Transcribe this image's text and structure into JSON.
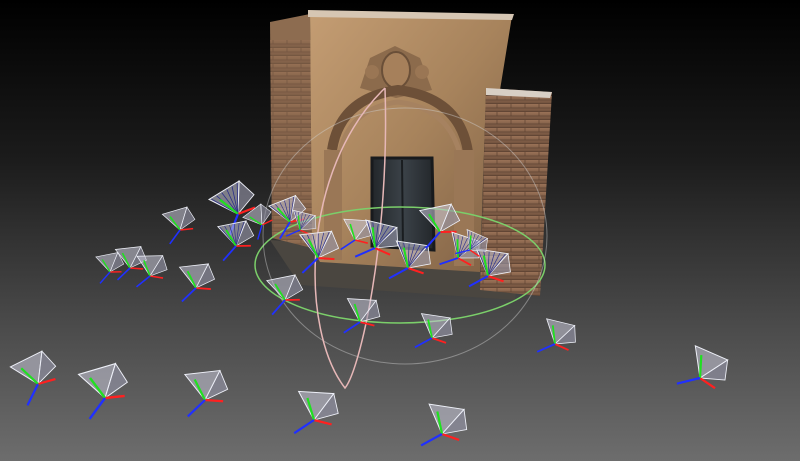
{
  "viewport": {
    "background_top": "#000000",
    "background_bottom": "#6d6d6d"
  },
  "model": {
    "subject": "photogrammetry-reconstruction-church-portal",
    "stone_color": "#b08a62",
    "brick_color": "#8a6448",
    "door_color": "#2e3338"
  },
  "gizmo": {
    "ring_color": "#7bcf6a",
    "arc_color": "#e6b7b7",
    "rotation_ring_color": "#d0d0d0"
  },
  "cameras": {
    "count": 28,
    "frustum_color": "#c8c8d8",
    "axis_colors": {
      "x": "#ff2020",
      "y": "#20e020",
      "z": "#2030ff"
    }
  }
}
